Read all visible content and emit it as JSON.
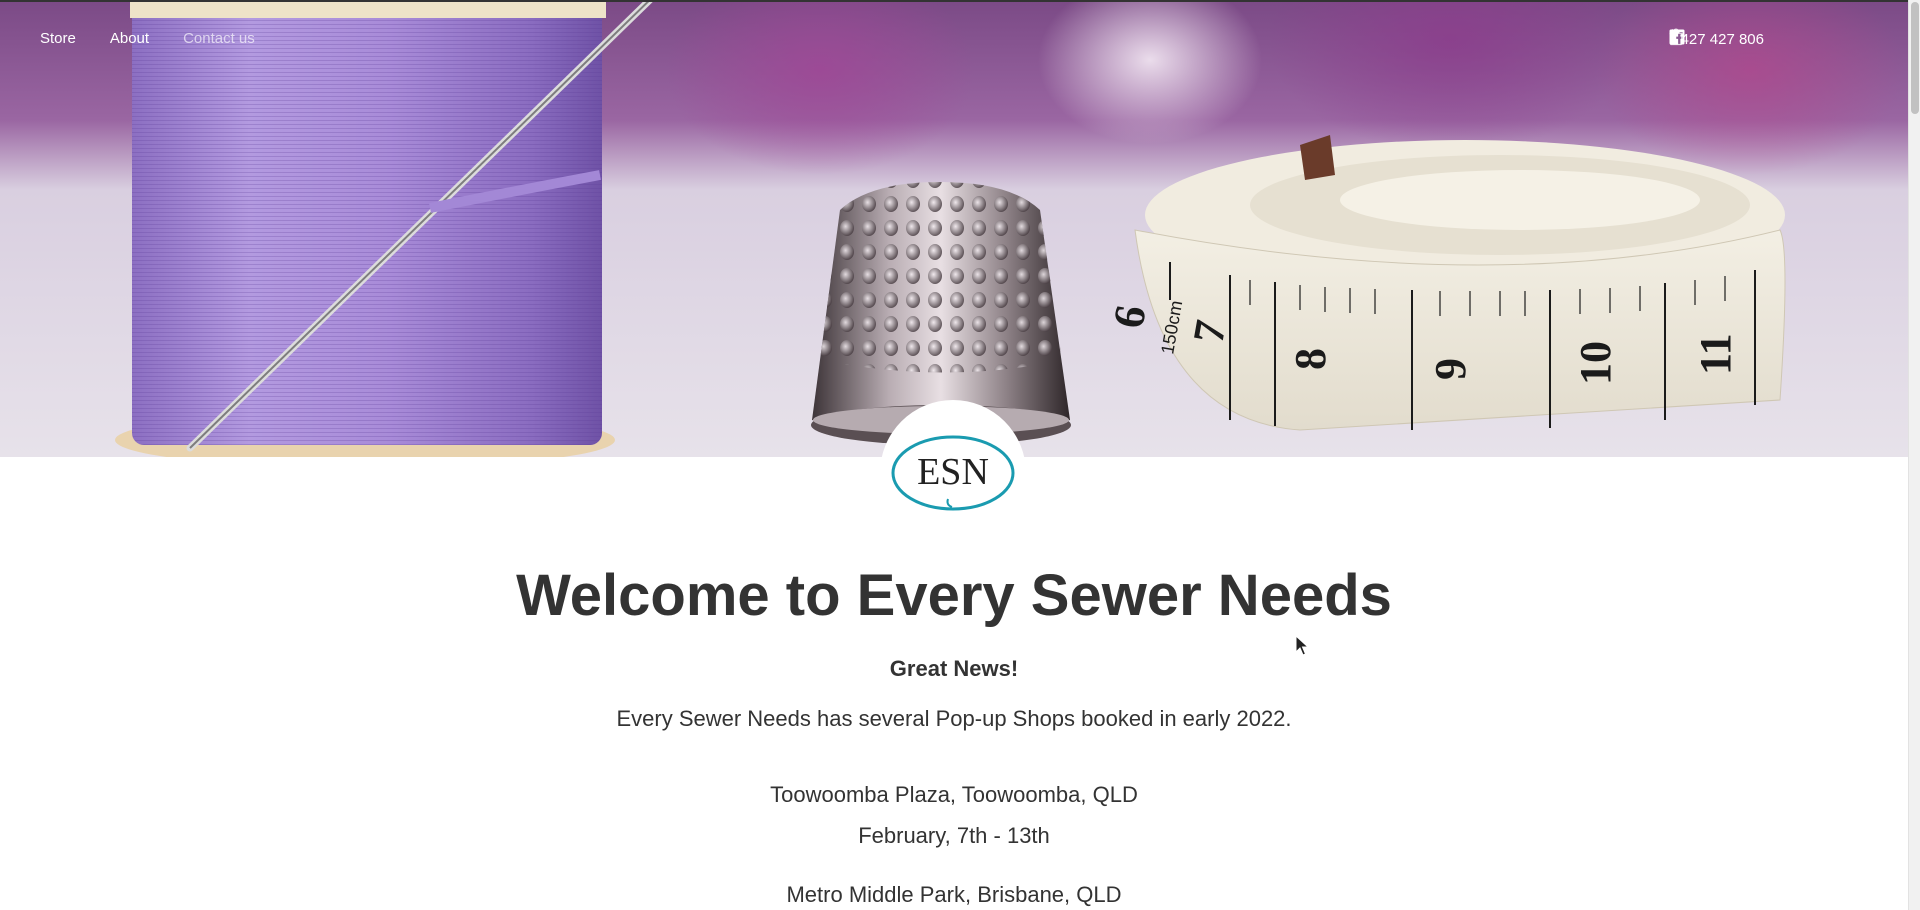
{
  "nav": {
    "links": [
      {
        "label": "Store"
      },
      {
        "label": "About"
      },
      {
        "label": "Contact us"
      }
    ],
    "phone": "0427 427 806",
    "icons": [
      "phone-icon",
      "instagram-icon",
      "facebook-icon",
      "shopping-bag-icon"
    ]
  },
  "logo": {
    "letters": "ESN",
    "color": "#1a9bb0"
  },
  "hero": {
    "tape_numbers": [
      "6",
      "7",
      "8",
      "9",
      "10",
      "11"
    ],
    "tape_unit": "150cm"
  },
  "content": {
    "headline": "Welcome to Every Sewer Needs",
    "subhead": "Great News!",
    "intro": "Every Sewer Needs has several Pop-up Shops booked in early 2022.",
    "events": [
      {
        "place": "Toowoomba Plaza, Toowoomba, QLD",
        "dates": "February, 7th - 13th"
      },
      {
        "place": "Metro Middle Park, Brisbane, QLD",
        "dates": ""
      }
    ]
  },
  "colors": {
    "text": "#333333",
    "thread": "#a98bd6",
    "logo_teal": "#1a9bb0"
  }
}
